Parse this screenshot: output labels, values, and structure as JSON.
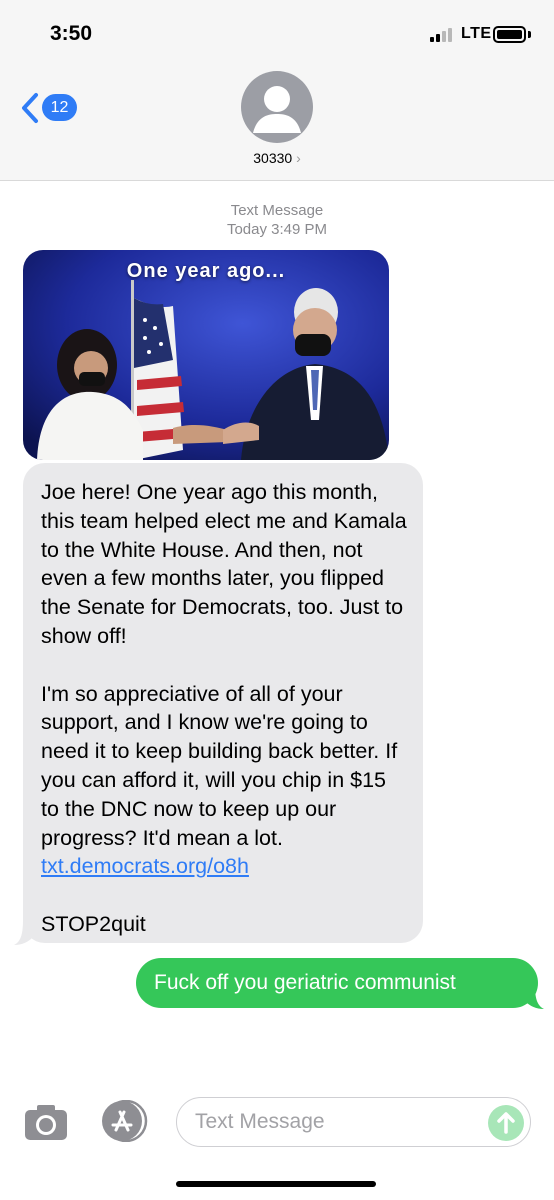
{
  "status_bar": {
    "time": "3:50",
    "network": "LTE",
    "signal_bars_filled": 2,
    "signal_bars_total": 4,
    "battery_level": 1.0
  },
  "header": {
    "back_badge": "12",
    "contact_name": "30330",
    "contact_chevron": "›",
    "avatar_icon": "person-placeholder-icon"
  },
  "thread": {
    "service": "Text Message",
    "timestamp": "Today 3:49 PM"
  },
  "incoming_image": {
    "caption": "One year ago..."
  },
  "incoming_message": {
    "paragraph_1": "Joe here! One year ago this month, this team helped elect me and Kamala to the White House. And then, not even a few months later, you flipped the Senate for Democrats, too. Just to show off!",
    "paragraph_2_text": "I'm so appreciative of all of your support, and I know we're going to need it to keep building back better. If you can afford it, will you chip in $15 to the DNC now to keep up our progress? It'd mean a lot.",
    "paragraph_2_link": "txt.democrats.org/o8h",
    "paragraph_3": "STOP2quit"
  },
  "outgoing_message": {
    "text": "Fuck off you geriatric communist"
  },
  "composer": {
    "placeholder": "Text Message",
    "camera_icon": "camera-icon",
    "apps_icon": "app-store-icon",
    "send_icon": "arrow-up-icon"
  },
  "colors": {
    "ios_blue": "#2f7cf6",
    "imessage_green": "#35c759",
    "incoming_bubble": "#e9e9eb",
    "header_bg": "#f6f6f6"
  }
}
